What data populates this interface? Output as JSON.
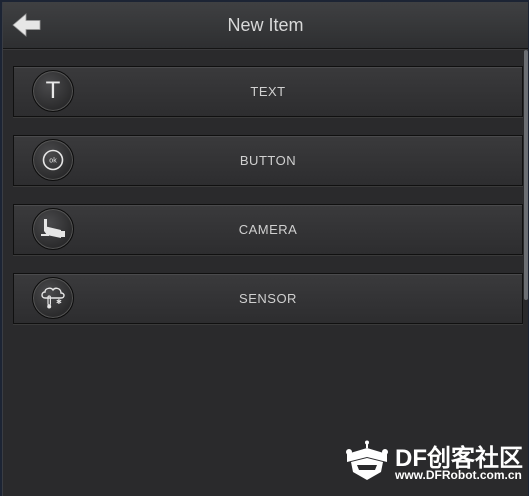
{
  "header": {
    "title": "New Item",
    "back_icon": "back-arrow-icon"
  },
  "items": [
    {
      "label": "TEXT",
      "icon": "text-icon"
    },
    {
      "label": "BUTTON",
      "icon": "ok-button-icon"
    },
    {
      "label": "CAMERA",
      "icon": "camera-icon"
    },
    {
      "label": "SENSOR",
      "icon": "sensor-icon"
    }
  ],
  "icon_glyphs": {
    "text": "T",
    "ok": "ok"
  },
  "watermark": {
    "brand": "DF创客社区",
    "url": "www.DFRobot.com.cn"
  },
  "colors": {
    "background": "#2a2a2c",
    "header": "#3a3a3c",
    "text": "#d0d0d0"
  }
}
